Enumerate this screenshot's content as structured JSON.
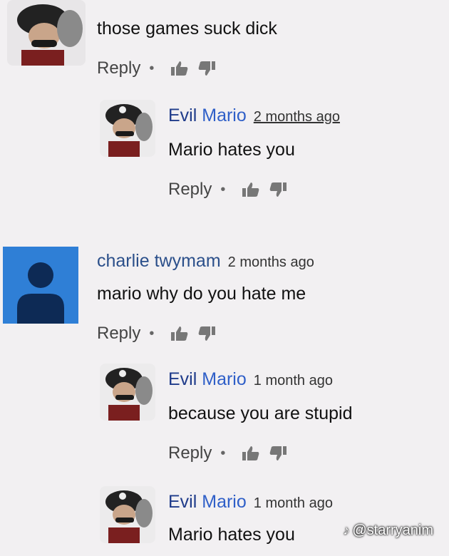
{
  "comments": [
    {
      "author": "",
      "time": "",
      "text": "those games suck dick",
      "reply_label": "Reply",
      "avatar": "evil-mario-avatar"
    },
    {
      "author_first": "Evil",
      "author_second": "Mario",
      "time": "2 months ago",
      "text": "Mario hates you",
      "reply_label": "Reply",
      "avatar": "evil-mario-avatar"
    },
    {
      "author": "charlie twymam",
      "time": "2 months ago",
      "text": "mario why do you hate me",
      "reply_label": "Reply",
      "avatar": "default-user-avatar"
    },
    {
      "author_first": "Evil",
      "author_second": "Mario",
      "time": "1 month ago",
      "text": "because you are stupid",
      "reply_label": "Reply",
      "avatar": "evil-mario-avatar"
    },
    {
      "author_first": "Evil",
      "author_second": "Mario",
      "time": "1 month ago",
      "text": "Mario hates you",
      "reply_label": "",
      "avatar": "evil-mario-avatar"
    }
  ],
  "watermark": {
    "handle": "@starryanim"
  },
  "colors": {
    "background": "#f2f0f2",
    "author_blue": "#2b4f8a",
    "default_avatar": "#2f7fd6"
  }
}
